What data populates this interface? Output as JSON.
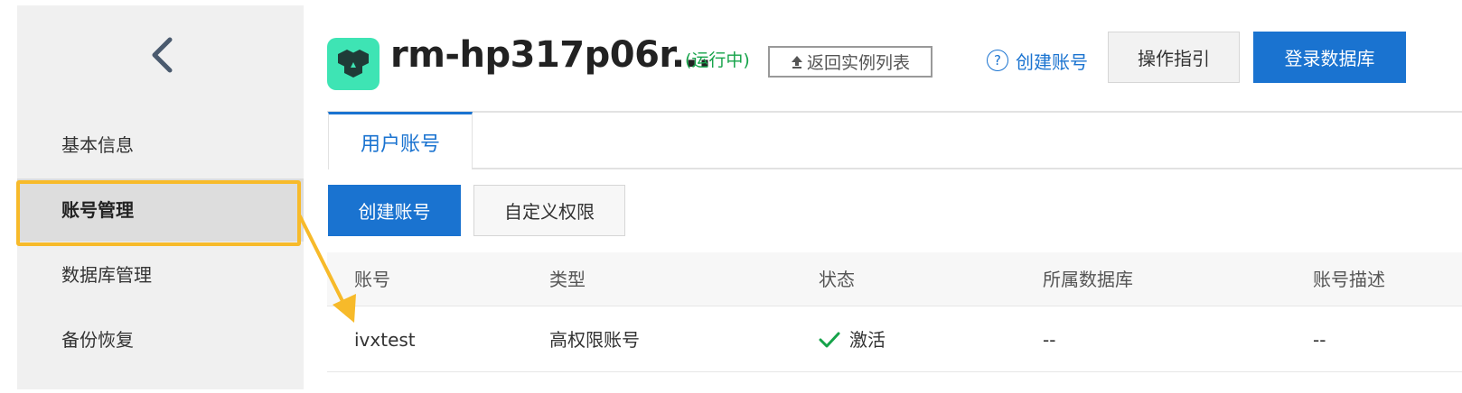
{
  "sidebar": {
    "back_icon": "chevron-left-icon",
    "items": [
      {
        "label": "基本信息"
      },
      {
        "label": "账号管理",
        "active": true
      },
      {
        "label": "数据库管理"
      },
      {
        "label": "备份恢复"
      }
    ]
  },
  "header": {
    "instance_name": "rm-hp317p06r...",
    "instance_status": "(运行中)",
    "return_label": "返回实例列表",
    "help_link_label": "创建账号",
    "guide_button_label": "操作指引",
    "login_button_label": "登录数据库"
  },
  "tabs": [
    {
      "label": "用户账号"
    }
  ],
  "toolbar": {
    "create_label": "创建账号",
    "custom_perm_label": "自定义权限"
  },
  "table": {
    "columns": [
      "账号",
      "类型",
      "状态",
      "所属数据库",
      "账号描述"
    ],
    "rows": [
      {
        "account": "ivxtest",
        "type": "高权限账号",
        "status": "激活",
        "database": "--",
        "description": "--"
      }
    ]
  },
  "colors": {
    "primary": "#1a73d0",
    "highlight": "#f7ba2a",
    "status_green": "#16a34a",
    "logo_bg": "#3ee4b4"
  }
}
